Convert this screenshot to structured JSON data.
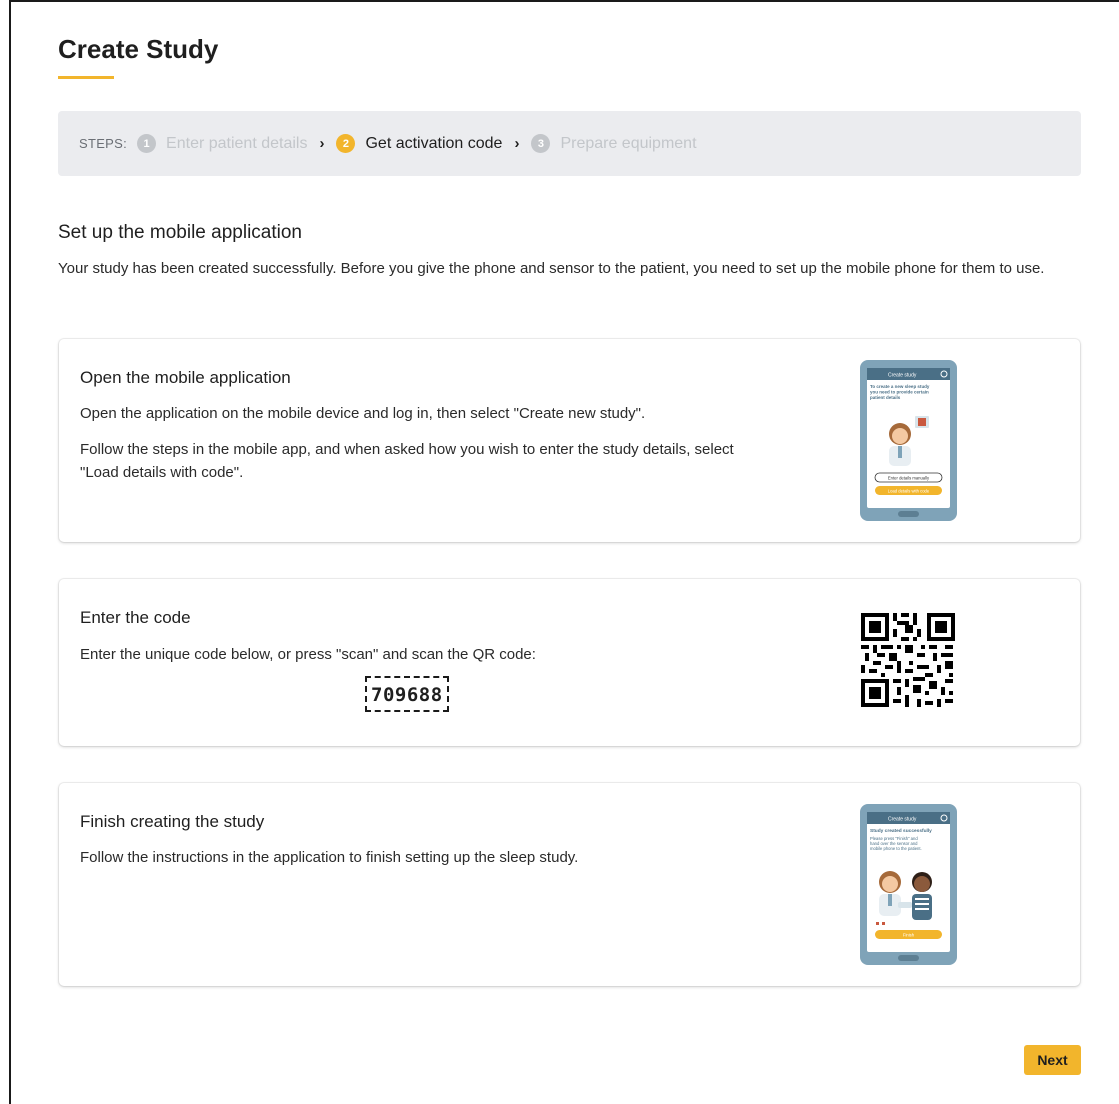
{
  "page": {
    "title": "Create Study"
  },
  "steps": {
    "label": "STEPS:",
    "items": [
      {
        "number": "1",
        "label": "Enter patient details",
        "state": "done"
      },
      {
        "number": "2",
        "label": "Get activation code",
        "state": "active"
      },
      {
        "number": "3",
        "label": "Prepare equipment",
        "state": "upcoming"
      }
    ]
  },
  "intro": {
    "heading": "Set up the mobile application",
    "description": "Your study has been created successfully. Before you give the phone and sensor to the patient, you need to set up the mobile phone for them to use."
  },
  "cards": [
    {
      "title": "Open the mobile application",
      "paragraphs": [
        "Open the application on the mobile device and log in, then select \"Create new study\".",
        "Follow the steps in the mobile app, and when asked how you wish to enter the study details, select \"Load details with code\"."
      ],
      "illustration": {
        "header": "Create study",
        "text": "To create a new sleep study you need to provide certain patient details",
        "button_outline": "Enter details manually",
        "button_primary": "Load details with code"
      }
    },
    {
      "title": "Enter the code",
      "paragraphs": [
        "Enter the unique code below, or press \"scan\" and scan the QR code:"
      ],
      "code": "709688",
      "qr_icon": "qr-code-icon"
    },
    {
      "title": "Finish creating the study",
      "paragraphs": [
        "Follow the instructions in the application to finish setting up the sleep study."
      ],
      "illustration": {
        "header": "Create study",
        "heading": "Study created successfully",
        "text": "Please press \"Finish\" and hand over the sensor and mobile phone to the patient.",
        "button_primary": "Finish"
      }
    }
  ],
  "footer": {
    "next_label": "Next"
  },
  "colors": {
    "accent": "#f2b52c",
    "steps_background": "#ebecef",
    "inactive_step": "#c3c6ca",
    "phone_frame": "#7fa3b8",
    "phone_header": "#4a6f86"
  }
}
